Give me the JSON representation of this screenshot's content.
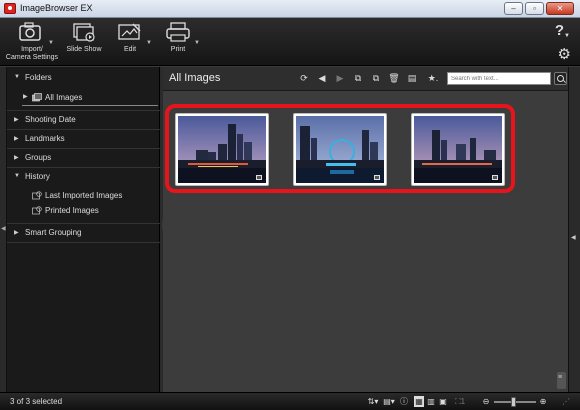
{
  "window": {
    "title": "ImageBrowser EX",
    "buttons": [
      "–",
      "▫",
      "✕"
    ]
  },
  "toolbar": {
    "items": [
      {
        "label_line1": "Import/",
        "label_line2": "Camera Settings",
        "icon": "camera-import-icon"
      },
      {
        "label_line1": "Slide Show",
        "label_line2": "",
        "icon": "slideshow-icon"
      },
      {
        "label_line1": "Edit",
        "label_line2": "",
        "icon": "edit-photo-icon"
      },
      {
        "label_line1": "Print",
        "label_line2": "",
        "icon": "printer-icon"
      }
    ],
    "help": "?",
    "settings": "⚙"
  },
  "sidebar": {
    "folders": "Folders",
    "all_images": "All Images",
    "shooting_date": "Shooting Date",
    "landmarks": "Landmarks",
    "groups": "Groups",
    "history": "History",
    "last_imported": "Last Imported Images",
    "printed": "Printed Images",
    "smart_grouping": "Smart Grouping"
  },
  "main": {
    "title": "All Images",
    "search_placeholder": "Search with text...",
    "header_icons": [
      "refresh-icon",
      "back-icon",
      "forward-icon",
      "copy-icon",
      "move-icon",
      "delete-icon",
      "view-mode-icon",
      "rating-filter-icon"
    ],
    "images": [
      {
        "name": "city-night-1",
        "sky_top": "#4a5a9a",
        "sky_bottom": "#c9a8c8"
      },
      {
        "name": "city-night-2",
        "sky_top": "#5a6fa8",
        "sky_bottom": "#b0c0e0"
      },
      {
        "name": "city-night-3",
        "sky_top": "#4a5a9a",
        "sky_bottom": "#d0a8c0"
      }
    ],
    "highlight_color": "#e8141b"
  },
  "status": {
    "selection": "3 of 3 selected",
    "zoom_level": 0.45
  }
}
